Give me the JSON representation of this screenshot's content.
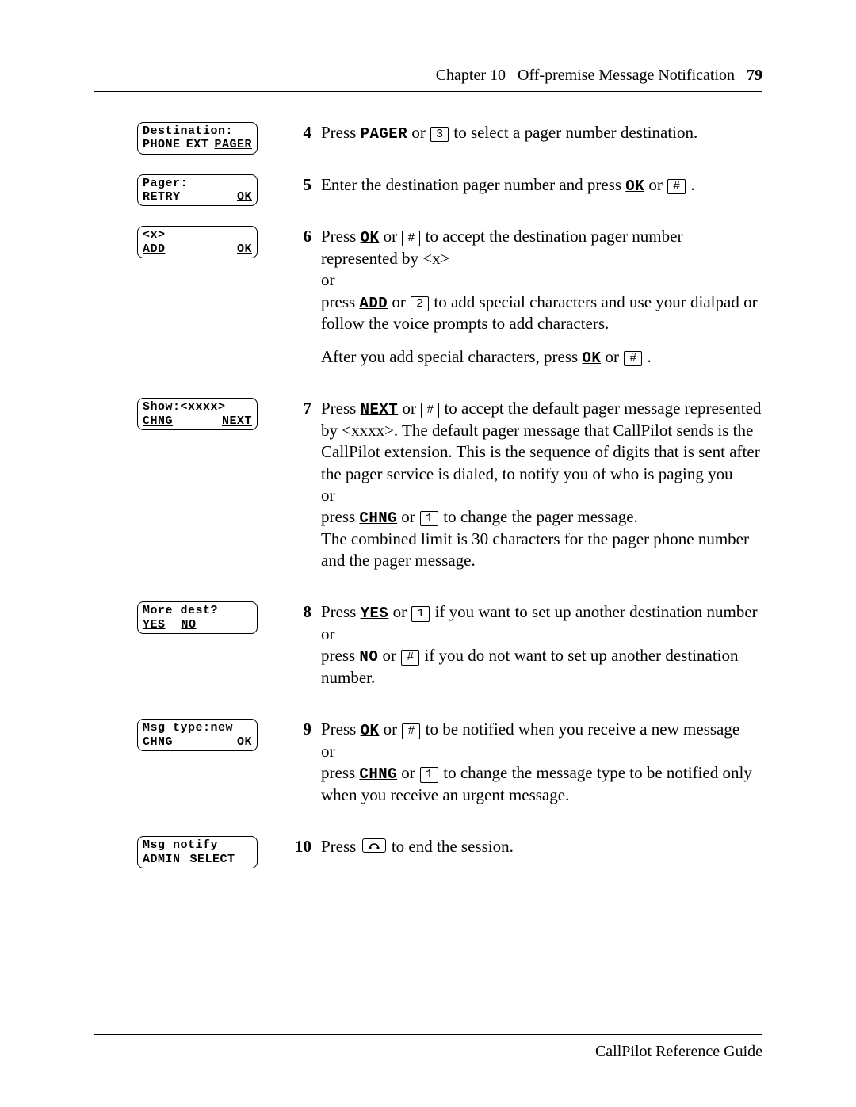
{
  "header": {
    "chapter": "Chapter 10",
    "title": "Off-premise Message Notification",
    "page": "79"
  },
  "footer": {
    "text": "CallPilot Reference Guide"
  },
  "keys": {
    "k1": "1",
    "k2": "2",
    "k3": "3",
    "hash": "#"
  },
  "softkeys": {
    "pager": "PAGER",
    "ok": "OK",
    "add": "ADD",
    "next": "NEXT",
    "chng": "CHNG",
    "yes": "YES",
    "no": "NO"
  },
  "steps": {
    "s4": {
      "num": "4",
      "lcd": {
        "l1": "Destination:",
        "l2a": "PHONE",
        "l2b": "EXT",
        "l2c": "PAGER"
      },
      "t1": "Press ",
      "t2": " or ",
      "t3": " to select a pager number destination."
    },
    "s5": {
      "num": "5",
      "lcd": {
        "l1": "Pager:",
        "l2a": "RETRY",
        "l2c": "OK"
      },
      "t1": "Enter the destination pager number and press ",
      "t2": " or ",
      "t3": " ."
    },
    "s6": {
      "num": "6",
      "lcd": {
        "l1": "<x>",
        "l2a": "ADD",
        "l2c": "OK"
      },
      "t1": "Press ",
      "t2": " or ",
      "t3": " to accept the destination pager number represented by <x>",
      "t4": "or",
      "t5": "press ",
      "t6": " or ",
      "t7": " to add special characters and use your dialpad or follow the voice prompts to add characters.",
      "t8": "After you add special characters, press ",
      "t9": " or ",
      "t10": " ."
    },
    "s7": {
      "num": "7",
      "lcd": {
        "l1": "Show:<xxxx>",
        "l2a": "CHNG",
        "l2c": "NEXT"
      },
      "t1": "Press ",
      "t2": " or ",
      "t3": " to accept the default pager message represented by <xxxx>. The default pager message that CallPilot sends is the CallPilot extension. This is the sequence of digits that is sent after the pager service is dialed, to notify you of who is paging you",
      "t4": "or",
      "t5": "press ",
      "t6": " or ",
      "t7": " to change the pager message.",
      "t8": "The combined limit is 30 characters for the pager phone number and the pager message."
    },
    "s8": {
      "num": "8",
      "lcd": {
        "l1": "More dest?",
        "l2a": "YES",
        "l2b": "NO"
      },
      "t1": "Press ",
      "t2": " or ",
      "t3": " if you want to set up another destination number",
      "t4": "or",
      "t5": "press ",
      "t6": " or ",
      "t7": " if you do not want to set up another destination number."
    },
    "s9": {
      "num": "9",
      "lcd": {
        "l1": "Msg type:new",
        "l2a": "CHNG",
        "l2c": "OK"
      },
      "t1": "Press ",
      "t2": " or ",
      "t3": " to be notified when you receive a new message",
      "t4": "or",
      "t5": "press ",
      "t6": " or ",
      "t7": " to change the message type to be notified only when you receive an urgent message."
    },
    "s10": {
      "num": "10",
      "lcd": {
        "l1": "Msg notify",
        "l2a": "ADMIN",
        "l2b": "SELECT"
      },
      "t1": "Press ",
      "t2": " to end the session."
    }
  }
}
